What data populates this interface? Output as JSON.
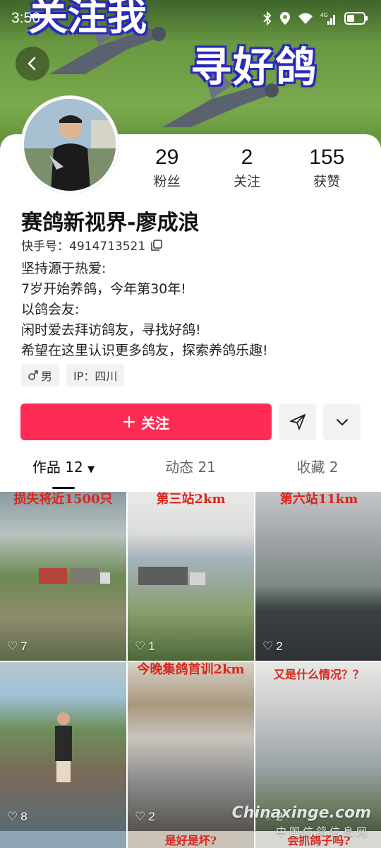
{
  "status_bar": {
    "time": "3:56",
    "network": "4G"
  },
  "banner": {
    "top_text": "关注我",
    "title": "寻好鸽"
  },
  "profile": {
    "name": "赛鸽新视界-廖成浪",
    "uid_label": "快手号：",
    "uid": "4914713521",
    "stats": [
      {
        "num": "29",
        "label": "粉丝"
      },
      {
        "num": "2",
        "label": "关注"
      },
      {
        "num": "155",
        "label": "获赞"
      }
    ],
    "bio": [
      "坚持源于热爱:",
      "7岁开始养鸽，今年第30年!",
      "以鸽会友:",
      "闲时爱去拜访鸽友，寻找好鸽!",
      "希望在这里认识更多鸽友，探索养鸽乐趣!"
    ],
    "gender_tag": "男",
    "ip_tag": "IP：四川"
  },
  "actions": {
    "follow_label": "关注"
  },
  "tabs": [
    {
      "label": "作品 12"
    },
    {
      "label": "动态 21"
    },
    {
      "label": "收藏 2"
    }
  ],
  "videos": [
    {
      "caption": "损失将近1500只",
      "likes": "7"
    },
    {
      "caption": "第三站2km",
      "likes": "1"
    },
    {
      "caption": "第六站11km",
      "likes": "2"
    },
    {
      "caption": "",
      "likes": "8"
    },
    {
      "caption": "今晚集鸽首训2km",
      "likes": "2"
    },
    {
      "caption": "又是什么情况？？",
      "likes": "2"
    }
  ],
  "bottom_row": [
    {
      "caption": ""
    },
    {
      "caption": "是好是坏?"
    },
    {
      "caption": "会抓鸽子吗?"
    }
  ],
  "watermark": {
    "line1": "Chinaxinge.com",
    "line2": "中国信鸽信息网"
  },
  "colors": {
    "accent": "#fe2c55",
    "banner_text_outline": "#2a2ab8"
  }
}
